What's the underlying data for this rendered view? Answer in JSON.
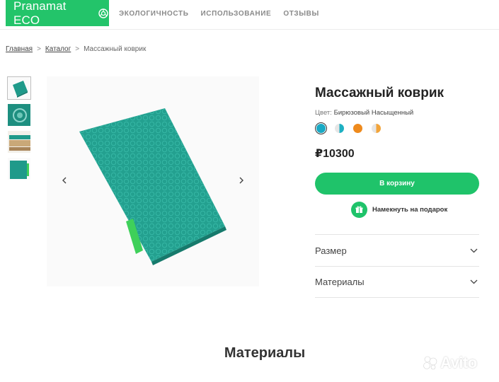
{
  "header": {
    "logo_text": "Pranamat ECO",
    "nav": [
      "ЭКОЛОГИЧНОСТЬ",
      "ИСПОЛЬЗОВАНИЕ",
      "ОТЗЫВЫ"
    ]
  },
  "breadcrumb": {
    "home": "Главная",
    "sep": ">",
    "catalog": "Каталог",
    "current": "Массажный коврик"
  },
  "product": {
    "title": "Массажный коврик",
    "color_label": "Цвет:",
    "color_value": "Бирюзовый Насыщенный",
    "swatches": [
      {
        "name": "turquoise",
        "color": "#19a9c4"
      },
      {
        "name": "turquoise-white",
        "color": "#1eb0c2"
      },
      {
        "name": "orange",
        "color": "#ee8a1d"
      },
      {
        "name": "orange-white",
        "color": "#f2a43a"
      }
    ],
    "price": "₽10300",
    "cart_button": "В корзину",
    "gift_label": "Намекнуть на подарок",
    "accordion": [
      "Размер",
      "Материалы"
    ]
  },
  "section_title": "Материалы",
  "watermark": "Avito",
  "colors": {
    "brand_green": "#23c46a",
    "mat_teal": "#1f9a8a"
  }
}
